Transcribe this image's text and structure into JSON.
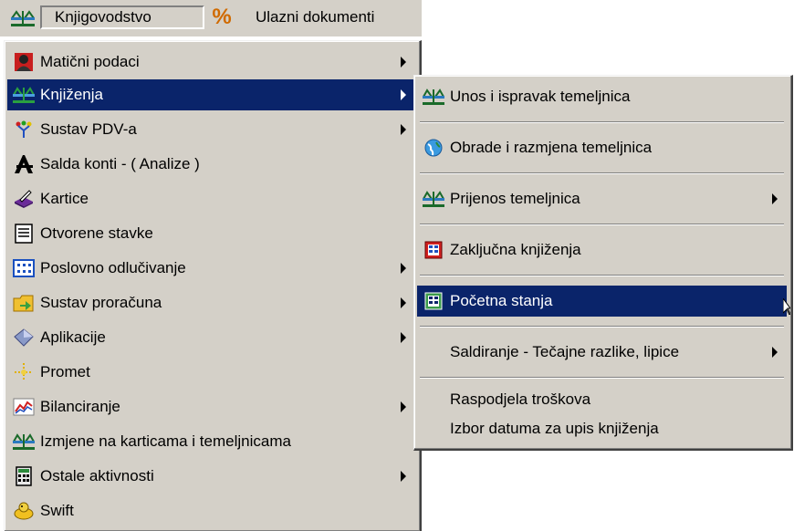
{
  "menubar": {
    "items": [
      {
        "label": "Knjigovodstvo",
        "icon": "scales-icon",
        "active": true
      },
      {
        "label": "Ulazni dokumenti",
        "icon": "percent-icon",
        "active": false
      }
    ],
    "percent_glyph": "%"
  },
  "main_menu": {
    "items": [
      {
        "label": "Matični podaci",
        "icon": "person-icon",
        "submenu": true
      },
      {
        "label": "Knjiženja",
        "icon": "scales-icon",
        "submenu": true,
        "selected": true
      },
      {
        "label": "Sustav PDV-a",
        "icon": "tax-icon",
        "submenu": true
      },
      {
        "label": "Salda konti - ( Analize )",
        "icon": "analysis-icon",
        "submenu": false
      },
      {
        "label": "Kartice",
        "icon": "cards-icon",
        "submenu": false
      },
      {
        "label": "Otvorene stavke",
        "icon": "document-icon",
        "submenu": false
      },
      {
        "label": "Poslovno odlučivanje",
        "icon": "grid-icon",
        "submenu": true
      },
      {
        "label": "Sustav proračuna",
        "icon": "budget-icon",
        "submenu": true
      },
      {
        "label": "Aplikacije",
        "icon": "apps-icon",
        "submenu": true
      },
      {
        "label": "Promet",
        "icon": "arrows-icon",
        "submenu": false
      },
      {
        "label": "Bilanciranje",
        "icon": "chart-icon",
        "submenu": true
      },
      {
        "label": "Izmjene na karticama i temeljnicama",
        "icon": "scales-icon",
        "submenu": false
      },
      {
        "label": "Ostale aktivnosti",
        "icon": "calculator-icon",
        "submenu": true
      },
      {
        "label": "Swift",
        "icon": "swift-icon",
        "submenu": false
      }
    ]
  },
  "sub_menu": {
    "items": [
      {
        "label": "Unos i ispravak temeljnica",
        "icon": "scales-icon",
        "submenu": false
      },
      {
        "label": "Obrade i razmjena temeljnica",
        "icon": "globe-icon",
        "submenu": false
      },
      {
        "label": "Prijenos temeljnica",
        "icon": "scales-icon",
        "submenu": true
      },
      {
        "label": "Zaključna knjiženja",
        "icon": "ledger-icon",
        "submenu": false
      },
      {
        "label": "Početna stanja",
        "icon": "ledger-icon",
        "submenu": false,
        "selected": true
      },
      {
        "label": "Saldiranje - Tečajne razlike, lipice",
        "icon": "",
        "submenu": true
      },
      {
        "label": "Raspodjela troškova",
        "icon": "",
        "submenu": false
      },
      {
        "label": "Izbor datuma za upis knjiženja",
        "icon": "",
        "submenu": false
      }
    ]
  },
  "colors": {
    "menu_bg": "#d4d0c8",
    "highlight": "#0a246a",
    "percent": "#d06a00"
  }
}
